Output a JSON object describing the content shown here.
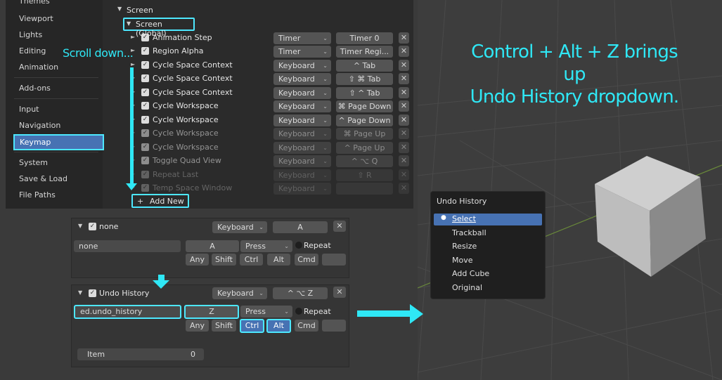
{
  "sidebar": {
    "items": [
      {
        "label": "Themes"
      },
      {
        "label": "Viewport"
      },
      {
        "label": "Lights"
      },
      {
        "label": "Editing"
      },
      {
        "label": "Animation"
      },
      {
        "label": "Add-ons"
      },
      {
        "label": "Input"
      },
      {
        "label": "Navigation"
      },
      {
        "label": "Keymap"
      },
      {
        "label": "System"
      },
      {
        "label": "Save & Load"
      },
      {
        "label": "File Paths"
      }
    ]
  },
  "keymap": {
    "section": "Screen",
    "subsection": "Screen (Global)",
    "rows": [
      {
        "name": "Animation Step",
        "type": "Timer",
        "key": "Timer 0"
      },
      {
        "name": "Region Alpha",
        "type": "Timer",
        "key": "Timer Regi..."
      },
      {
        "name": "Cycle Space Context",
        "type": "Keyboard",
        "key": "^ Tab"
      },
      {
        "name": "Cycle Space Context",
        "type": "Keyboard",
        "key": "⇧ ⌘ Tab"
      },
      {
        "name": "Cycle Space Context",
        "type": "Keyboard",
        "key": "⇧ ^ Tab"
      },
      {
        "name": "Cycle Workspace",
        "type": "Keyboard",
        "key": "⌘ Page Down"
      },
      {
        "name": "Cycle Workspace",
        "type": "Keyboard",
        "key": "^ Page Down"
      },
      {
        "name": "Cycle Workspace",
        "type": "Keyboard",
        "key": "⌘ Page Up"
      },
      {
        "name": "Cycle Workspace",
        "type": "Keyboard",
        "key": "^ Page Up"
      },
      {
        "name": "Toggle Quad View",
        "type": "Keyboard",
        "key": "^ ⌥ Q"
      },
      {
        "name": "Repeat Last",
        "type": "Keyboard",
        "key": "⇧ R"
      },
      {
        "name": "Temp Space Window",
        "type": "Keyboard",
        "key": ""
      }
    ],
    "add_new": "Add New",
    "add_new_icon": "+"
  },
  "panel1": {
    "name": "none",
    "type": "Keyboard",
    "key": "A",
    "idname": "none",
    "key_btn": "A",
    "event": "Press",
    "repeat": "Repeat",
    "mods": [
      "Any",
      "Shift",
      "Ctrl",
      "Alt",
      "Cmd"
    ]
  },
  "panel2": {
    "name": "Undo History",
    "type": "Keyboard",
    "key": "^ ⌥ Z",
    "idname": "ed.undo_history",
    "key_btn": "Z",
    "event": "Press",
    "repeat": "Repeat",
    "mods": [
      "Any",
      "Shift",
      "Ctrl",
      "Alt",
      "Cmd"
    ],
    "item_label": "Item",
    "item_value": "0"
  },
  "annotations": {
    "scroll": "Scroll down...",
    "line1": "Control + Alt + Z brings up",
    "line2": "Undo History dropdown."
  },
  "undo_history": {
    "title": "Undo History",
    "items": [
      {
        "label": "Select"
      },
      {
        "label": "Trackball"
      },
      {
        "label": "Resize"
      },
      {
        "label": "Move"
      },
      {
        "label": "Add Cube"
      },
      {
        "label": "Original"
      }
    ]
  },
  "colors": {
    "accent": "#4de8ff",
    "selection": "#4772b3",
    "annotation": "#2fe8f6"
  }
}
